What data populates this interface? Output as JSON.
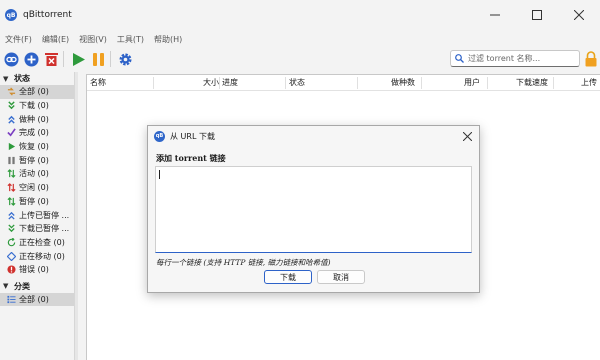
{
  "app": {
    "title": "qBittorrent",
    "logo_text": "qB"
  },
  "menu": [
    "文件(F)",
    "编辑(E)",
    "视图(V)",
    "工具(T)",
    "帮助(H)"
  ],
  "search": {
    "placeholder": "过滤 torrent 名称..."
  },
  "sidebar": {
    "status_header": "状态",
    "status_items": [
      {
        "label": "全部 (0)",
        "icon": "all-icon",
        "color": "#d08c2e",
        "selected": true
      },
      {
        "label": "下载 (0)",
        "icon": "download-icon",
        "color": "#2e9a3c"
      },
      {
        "label": "做种 (0)",
        "icon": "upload-icon",
        "color": "#3a6fd0"
      },
      {
        "label": "完成 (0)",
        "icon": "check-icon",
        "color": "#7b3fc2"
      },
      {
        "label": "恢复 (0)",
        "icon": "play-icon",
        "color": "#2e9a3c"
      },
      {
        "label": "暂停 (0)",
        "icon": "pause-icon",
        "color": "#777777"
      },
      {
        "label": "活动 (0)",
        "icon": "active-icon",
        "color": "#2e9a3c"
      },
      {
        "label": "空闲 (0)",
        "icon": "inactive-icon",
        "color": "#d0312d"
      },
      {
        "label": "暂停 (0)",
        "icon": "stalled-icon",
        "color": "#2e9a3c"
      },
      {
        "label": "上传已暂停 ...",
        "icon": "upload-paused-icon",
        "color": "#3a6fd0"
      },
      {
        "label": "下载已暂停 ...",
        "icon": "download-paused-icon",
        "color": "#2e9a3c"
      },
      {
        "label": "正在检查 (0)",
        "icon": "checking-icon",
        "color": "#2e9a3c"
      },
      {
        "label": "正在移动 (0)",
        "icon": "moving-icon",
        "color": "#3a6fd0"
      },
      {
        "label": "错误 (0)",
        "icon": "error-icon",
        "color": "#d0312d"
      }
    ],
    "category_header": "分类",
    "category_items": [
      {
        "label": "全部 (0)",
        "icon": "list-icon",
        "color": "#3a6fd0",
        "selected": true
      }
    ]
  },
  "table": {
    "columns": [
      "名称",
      "大小",
      "进度",
      "状态",
      "做种数",
      "用户",
      "下载速度",
      "上传"
    ]
  },
  "dialog": {
    "title": "从 URL 下载",
    "label": "添加 torrent 链接",
    "textarea_value": "",
    "hint": "每行一个链接 (支持 HTTP 链接, 磁力链接和哈希值)",
    "ok_label": "下载",
    "cancel_label": "取消"
  },
  "colors": {
    "accent": "#2d62c8",
    "brand": "#2f66c9"
  }
}
